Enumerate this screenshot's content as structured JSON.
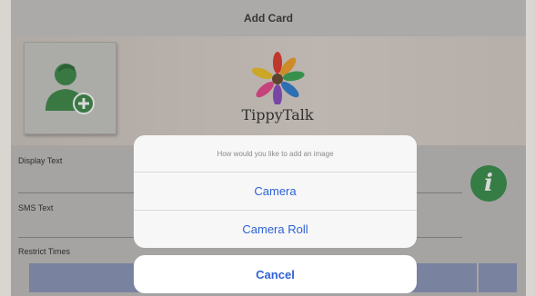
{
  "navbar": {
    "title": "Add Card"
  },
  "app": {
    "logo_name": "TippyTalk"
  },
  "form": {
    "display_text_label": "Display Text",
    "sms_text_label": "SMS Text",
    "restrict_times_label": "Restrict Times"
  },
  "action_sheet": {
    "title": "How would you like to add an image",
    "actions": [
      {
        "label": "Camera"
      },
      {
        "label": "Camera Roll"
      }
    ],
    "cancel_label": "Cancel"
  },
  "colors": {
    "accent_green": "#3a8f4c",
    "action_blue": "#2e62d6",
    "bar_blue": "#8f9bbd"
  },
  "icons": [
    "add-person-icon",
    "plus-icon",
    "info-icon",
    "tippytalk-logo"
  ]
}
